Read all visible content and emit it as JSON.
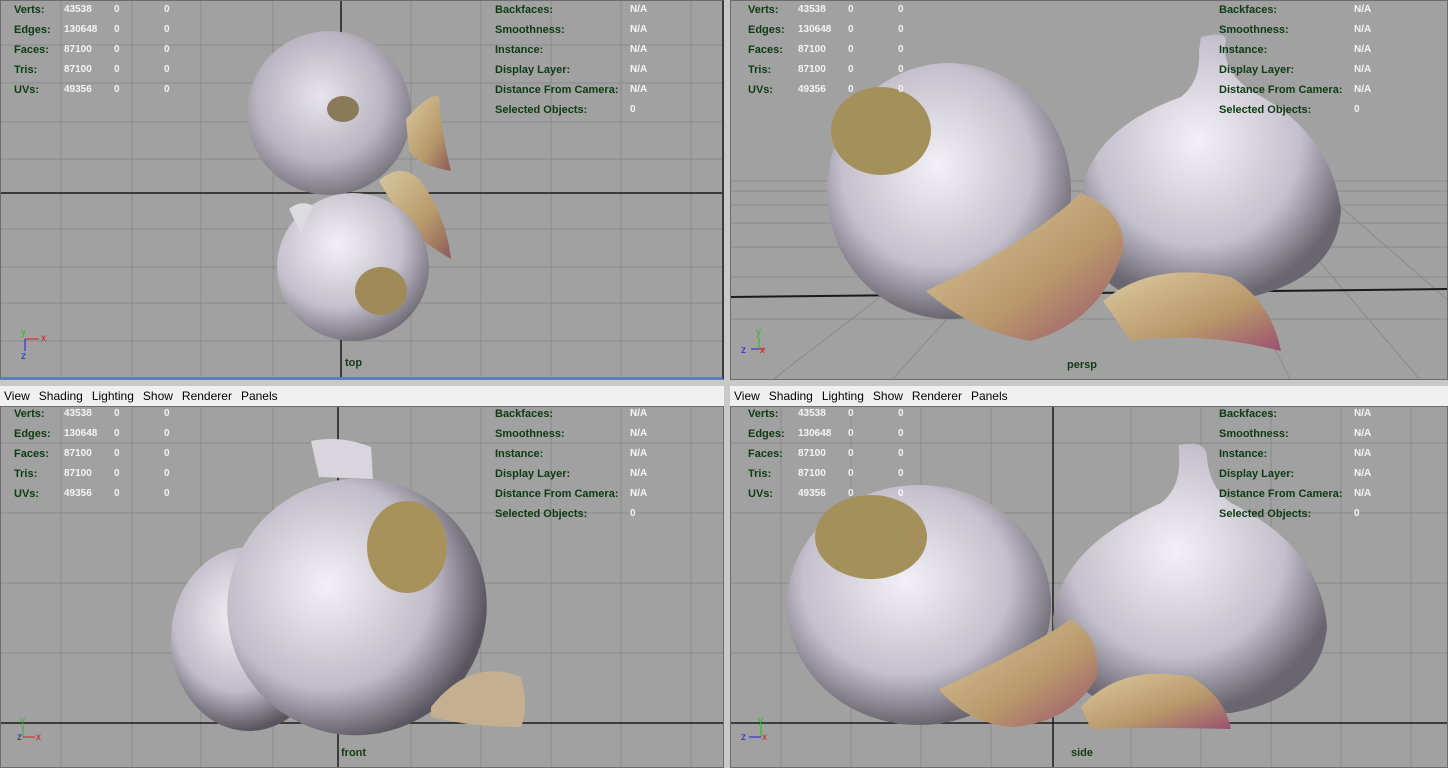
{
  "menu": [
    "View",
    "Shading",
    "Lighting",
    "Show",
    "Renderer",
    "Panels"
  ],
  "hud_left": {
    "labels": [
      "Verts:",
      "Edges:",
      "Faces:",
      "Tris:",
      "UVs:"
    ],
    "values": [
      [
        "43538",
        "0",
        "0"
      ],
      [
        "130648",
        "0",
        "0"
      ],
      [
        "87100",
        "0",
        "0"
      ],
      [
        "87100",
        "0",
        "0"
      ],
      [
        "49356",
        "0",
        "0"
      ]
    ]
  },
  "hud_right": {
    "labels": [
      "Backfaces:",
      "Smoothness:",
      "Instance:",
      "Display Layer:",
      "Distance From Camera:",
      "Selected Objects:"
    ],
    "values": [
      "N/A",
      "N/A",
      "N/A",
      "N/A",
      "N/A",
      "0"
    ]
  },
  "panels": {
    "top": {
      "camera": "top"
    },
    "persp": {
      "camera": "persp"
    },
    "front": {
      "camera": "front"
    },
    "side": {
      "camera": "side"
    }
  },
  "axis_labels": {
    "x": "x",
    "y": "y",
    "z": "z"
  },
  "colors": {
    "viewport_bg": "#a1a1a1",
    "grid": "#8a8a8a",
    "grid_axis": "#1a1a1a",
    "hud_label": "#0d3b12",
    "hud_value": "#f4f4f4",
    "axis_x": "#d42020",
    "axis_y": "#20c020",
    "axis_z": "#2020d4"
  }
}
